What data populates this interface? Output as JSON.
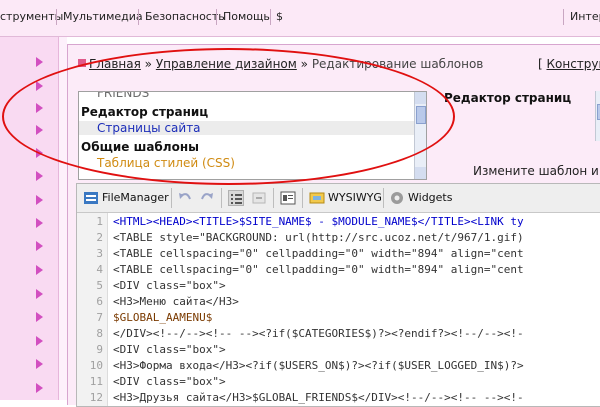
{
  "menu": {
    "items": [
      "струменты",
      "Мультимедиа",
      "Безопасность",
      "Помощь",
      "$",
      "Интер"
    ]
  },
  "breadcrumb": {
    "home": "Главная",
    "design": "Управление дизайном",
    "current": "Редактирование шаблонов",
    "right": "Конструкт",
    "sep": "»"
  },
  "templates": {
    "rows": [
      {
        "label": "FRIENDS",
        "kind": "sub",
        "color": "#6b6b6b"
      },
      {
        "label": "Редактор страниц",
        "kind": "group"
      },
      {
        "label": "Страницы сайта",
        "kind": "sub",
        "color": "#1b2cb8",
        "selected": true
      },
      {
        "label": "Общие шаблоны",
        "kind": "group"
      },
      {
        "label": "Таблица стилей (CSS)",
        "kind": "sub",
        "color": "#d08b12"
      }
    ]
  },
  "edit_title": "Редактор страниц",
  "hint": "Измените шаблон и на",
  "toolbar": {
    "filemanager": "FileManager",
    "wysiwyg": "WYSIWYG",
    "widgets": "Widgets"
  },
  "code": {
    "lines": [
      {
        "n": "1",
        "t": "<HTML><HEAD><TITLE>$SITE_NAME$ - $MODULE_NAME$</TITLE><LINK ty"
      },
      {
        "n": "2",
        "t": "<TABLE style=\"BACKGROUND: url(http://src.ucoz.net/t/967/1.gif)"
      },
      {
        "n": "3",
        "t": "<TABLE cellspacing=\"0\" cellpadding=\"0\" width=\"894\" align=\"cent"
      },
      {
        "n": "4",
        "t": "<TABLE cellspacing=\"0\" cellpadding=\"0\" width=\"894\" align=\"cent"
      },
      {
        "n": "5",
        "t": "<DIV class=\"box\">"
      },
      {
        "n": "6",
        "t": "<H3>Меню сайта</H3>"
      },
      {
        "n": "7",
        "t": "$GLOBAL_AAMENU$"
      },
      {
        "n": "8",
        "t": "</DIV><!--/--><!-- --><?if($CATEGORIES$)?><?endif?><!--/--><!-"
      },
      {
        "n": "9",
        "t": "<DIV class=\"box\">"
      },
      {
        "n": "10",
        "t": "<H3>Форма входа</H3><?if($USERS_ON$)?><?if($USER_LOGGED_IN$)?>"
      },
      {
        "n": "11",
        "t": "<DIV class=\"box\">"
      },
      {
        "n": "12",
        "t": "<H3>Друзья сайта</H3>$GLOBAL_FRIENDS$</DIV><!--/--><!-- --><!-"
      }
    ]
  },
  "colors": {
    "accent_pink": "#d24fc0",
    "annotation_red": "#e01010"
  }
}
